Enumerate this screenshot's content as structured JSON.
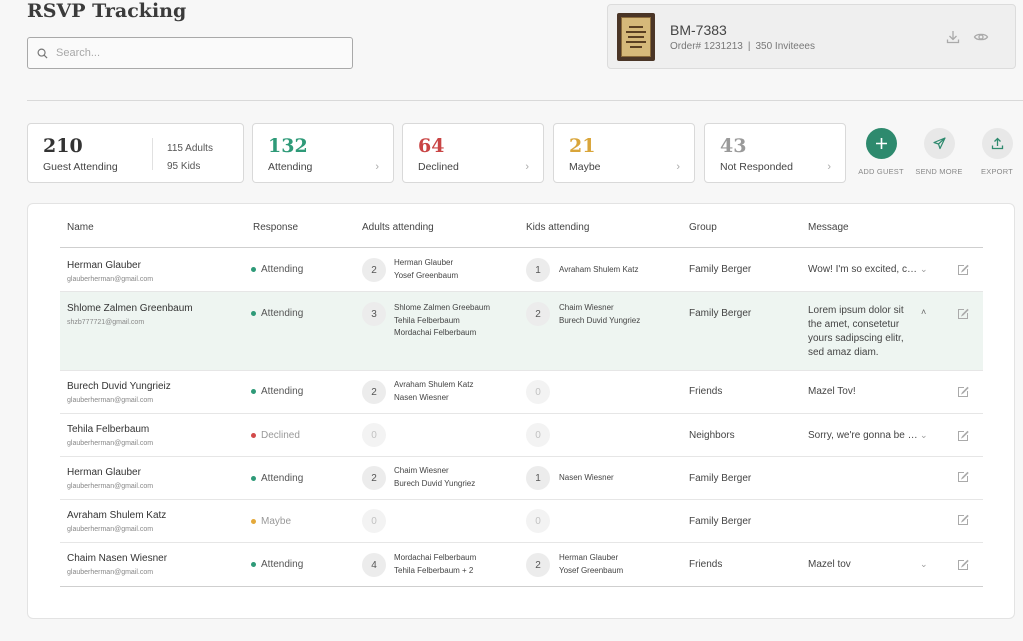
{
  "page": {
    "title": "RSVP Tracking"
  },
  "search": {
    "placeholder": "Search..."
  },
  "order": {
    "id": "BM-7383",
    "order_number": "Order# 1231213",
    "invitees": "350 Inviteees",
    "icons": [
      "download-icon",
      "eye-icon"
    ]
  },
  "stats": {
    "attending_total": {
      "value": "210",
      "label": "Guest Attending",
      "adults": "115 Adults",
      "kids": "95 Kids"
    },
    "attending": {
      "value": "132",
      "label": "Attending",
      "color": "#2e9a78"
    },
    "declined": {
      "value": "64",
      "label": "Declined",
      "color": "#c94545"
    },
    "maybe": {
      "value": "21",
      "label": "Maybe",
      "color": "#d9a53a"
    },
    "not_responded": {
      "value": "43",
      "label": "Not Responded",
      "color": "#9a9a9a"
    }
  },
  "actions": {
    "add_guest": "ADD GUEST",
    "send_more": "SEND MORE",
    "export": "EXPORT"
  },
  "colors": {
    "accent": "#2e8a6e",
    "attending": "#2e9a78",
    "declined": "#d24a4a",
    "maybe": "#e4a93a",
    "highlight_row": "#eef5f1"
  },
  "table": {
    "headers": [
      "Name",
      "Response",
      "Adults attending",
      "Kids attending",
      "Group",
      "Message"
    ],
    "rows": [
      {
        "name": "Herman Glauber",
        "email": "glauberherman@gmail.com",
        "response": "Attending",
        "adults_count": "2",
        "adults": [
          "Herman Glauber",
          "Yosef Greenbaum"
        ],
        "kids_count": "1",
        "kids": [
          "Avraham Shulem Katz"
        ],
        "group": "Family Berger",
        "message": "Wow! I'm so excited, can't wait"
      },
      {
        "name": "Shlome Zalmen Greenbaum",
        "email": "shzb777721@gmail.com",
        "response": "Attending",
        "adults_count": "3",
        "adults": [
          "Shlome Zalmen Greebaum",
          "Tehila Felberbaum",
          "Mordachai Felberbaum"
        ],
        "kids_count": "2",
        "kids": [
          "Chaim Wiesner",
          "Burech Duvid Yungriez"
        ],
        "group": "Family Berger",
        "message": "Lorem ipsum dolor sit the amet, consetetur yours sadipscing elitr, sed amaz diam."
      },
      {
        "name": "Burech Duvid Yungrieiz",
        "email": "glauberherman@gmail.com",
        "response": "Attending",
        "adults_count": "2",
        "adults": [
          "Avraham Shulem Katz",
          "Nasen Wiesner"
        ],
        "kids_count": "0",
        "kids": [],
        "group": "Friends",
        "message": "Mazel Tov!"
      },
      {
        "name": "Tehila Felberbaum",
        "email": "glauberherman@gmail.com",
        "response": "Declined",
        "adults_count": "0",
        "adults": [],
        "kids_count": "0",
        "kids": [],
        "group": "Neighbors",
        "message": "Sorry, we're gonna be away"
      },
      {
        "name": "Herman Glauber",
        "email": "glauberherman@gmail.com",
        "response": "Attending",
        "adults_count": "2",
        "adults": [
          "Chaim Wiesner",
          "Burech Duvid Yungriez"
        ],
        "kids_count": "1",
        "kids": [
          "Nasen Wiesner"
        ],
        "group": "Family Berger",
        "message": ""
      },
      {
        "name": "Avraham Shulem Katz",
        "email": "glauberherman@gmail.com",
        "response": "Maybe",
        "adults_count": "0",
        "adults": [],
        "kids_count": "0",
        "kids": [],
        "group": "Family Berger",
        "message": ""
      },
      {
        "name": "Chaim Nasen Wiesner",
        "email": "glauberherman@gmail.com",
        "response": "Attending",
        "adults_count": "4",
        "adults": [
          "Mordachai Felberbaum",
          "Tehila Felberbaum + 2"
        ],
        "kids_count": "2",
        "kids": [
          "Herman Glauber",
          "Yosef Greenbaum"
        ],
        "group": "Friends",
        "message": "Mazel tov"
      }
    ]
  }
}
